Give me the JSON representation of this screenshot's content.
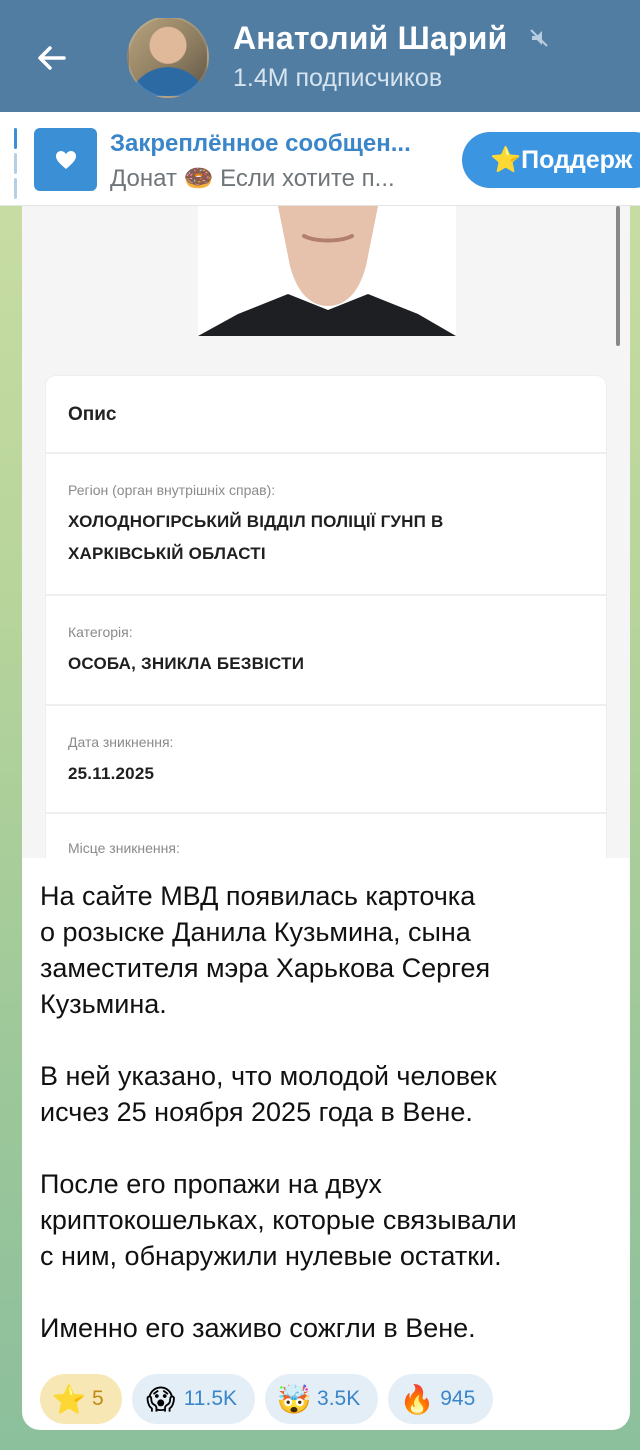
{
  "header": {
    "channel_name": "Анатолий Шарий",
    "subscribers": "1.4M подписчиков",
    "back_icon": "arrow-left-icon",
    "mute_icon": "muted-bell-icon",
    "bg_color": "#517da2"
  },
  "pinned": {
    "title": "Закреплённое сообщен...",
    "text": "Донат 🍩 Если хотите п...",
    "support_label": "⭐Поддерж",
    "thumb_icon": "heart-icon",
    "accent": "#3b95e0"
  },
  "card": {
    "heading": "Опис",
    "rows": [
      {
        "label": "Регіон (орган внутрішніх справ):",
        "value": "ХОЛОДНОГІРСЬКИЙ ВІДДІЛ ПОЛІЦІЇ ГУНП В\nХАРКІВСЬКІЙ ОБЛАСТІ"
      },
      {
        "label": "Категорія:",
        "value": "ОСОБА, ЗНИКЛА БЕЗВІСТИ"
      },
      {
        "label": "Дата зникнення:",
        "value": "25.11.2025"
      },
      {
        "label": "Місце зникнення:",
        "value": ""
      }
    ]
  },
  "message": {
    "text": "На сайте МВД появилась карточка\nо розыске Данила Кузьмина, сына\nзаместителя мэра Харькова Сергея\nКузьмина.\n\nВ ней указано, что молодой человек\nисчез 25 ноября 2025 года в Вене.\n\nПосле его пропажи на двух\nкриптокошельках, которые связывали\nс ним, обнаружили нулевые остатки.\n\nИменно его заживо сожгли в Вене."
  },
  "reactions": [
    {
      "emoji": "⭐",
      "count": "5",
      "name": "star"
    },
    {
      "emoji": "😱",
      "count": "11.5K",
      "name": "scream"
    },
    {
      "emoji": "🤯",
      "count": "3.5K",
      "name": "mind-blown"
    },
    {
      "emoji": "🔥",
      "count": "945",
      "name": "fire"
    }
  ]
}
